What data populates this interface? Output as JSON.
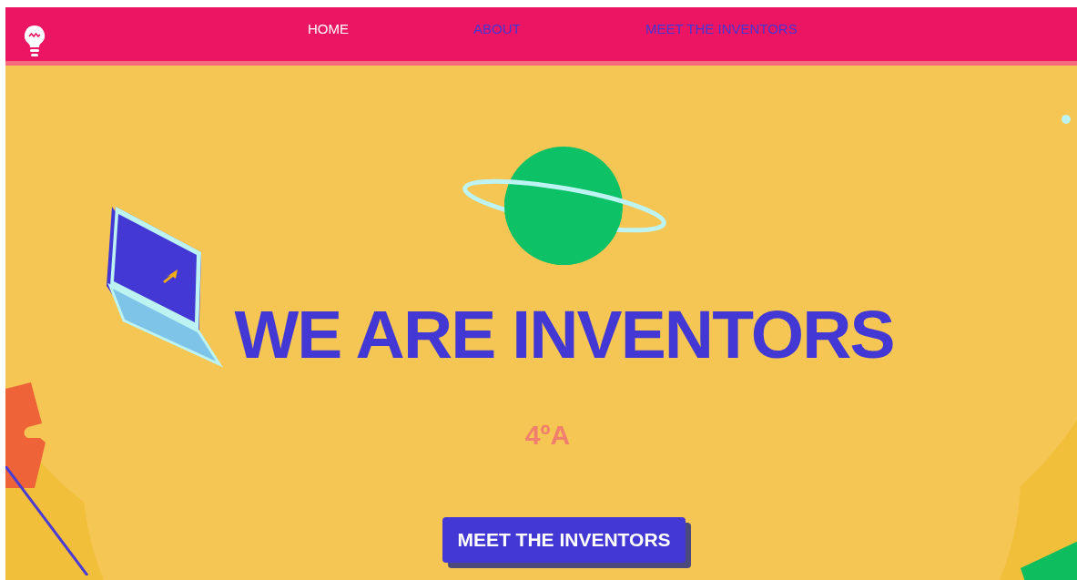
{
  "nav": {
    "links": [
      {
        "label": "HOME",
        "selected": true
      },
      {
        "label": "ABOUT",
        "selected": false
      },
      {
        "label": "MEET THE INVENTORS",
        "selected": false
      }
    ]
  },
  "hero": {
    "title": "WE ARE INVENTORS",
    "subtitle": "4ºA",
    "button": "MEET THE INVENTORS"
  }
}
